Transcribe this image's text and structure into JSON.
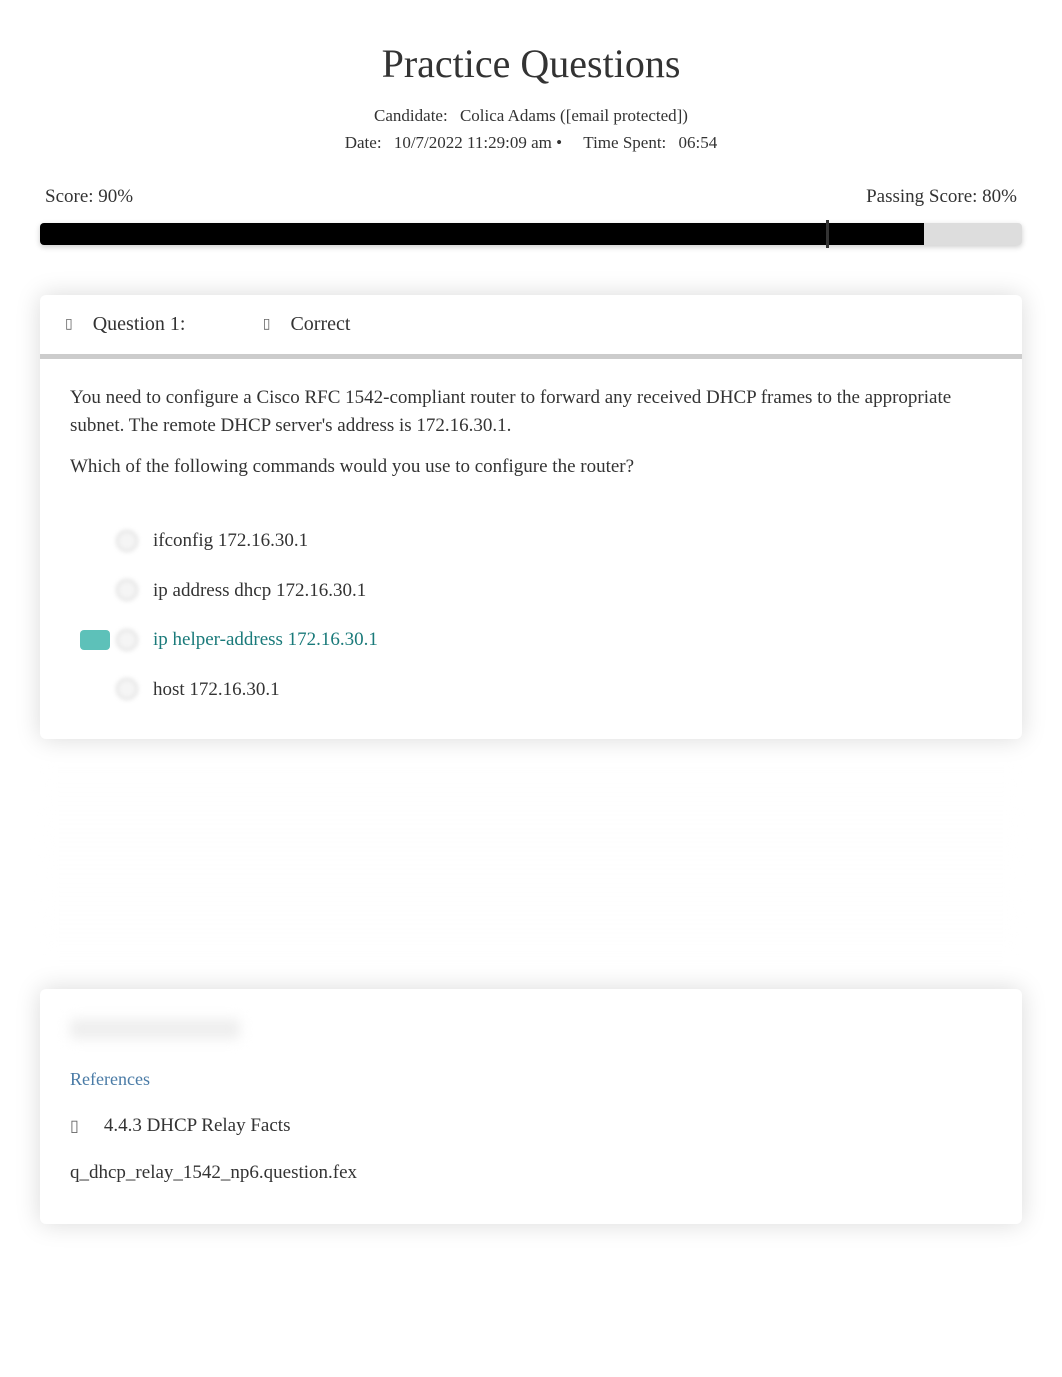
{
  "title": "Practice Questions",
  "meta": {
    "candidate_label": "Candidate:",
    "candidate_value": "Colica Adams ([email protected])",
    "date_label": "Date:",
    "date_value": "10/7/2022 11:29:09 am •",
    "time_spent_label": "Time Spent:",
    "time_spent_value": "06:54"
  },
  "score": {
    "label": "Score: 90%",
    "passing_label": "Passing Score: 80%",
    "fill_percent": 90,
    "marker_percent": 80
  },
  "question": {
    "label": "Question 1:",
    "status": "Correct",
    "text": "You need to configure a Cisco RFC 1542-compliant router to forward any received DHCP frames to the appropriate subnet. The remote DHCP server's address is 172.16.30.1.",
    "prompt": "Which of the following commands would you use to configure the router?",
    "answers": [
      {
        "text": "ifconfig 172.16.30.1",
        "correct": false
      },
      {
        "text": "ip address dhcp 172.16.30.1",
        "correct": false
      },
      {
        "text": "ip helper-address 172.16.30.1",
        "correct": true
      },
      {
        "text": "host 172.16.30.1",
        "correct": false
      }
    ]
  },
  "references": {
    "title": "References",
    "item": "4.4.3 DHCP Relay Facts",
    "file": "q_dhcp_relay_1542_np6.question.fex"
  }
}
